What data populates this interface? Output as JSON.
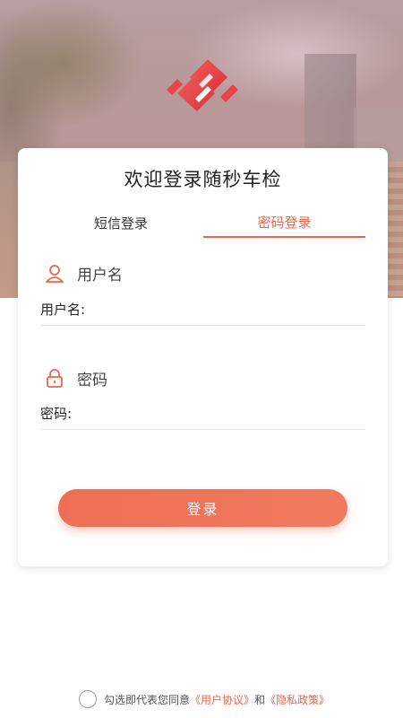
{
  "app": {
    "title": "欢迎登录随秒车检"
  },
  "tabs": [
    {
      "label": "短信登录",
      "active": false
    },
    {
      "label": "密码登录",
      "active": true
    }
  ],
  "username": {
    "section_label": "用户名",
    "placeholder": "用户名:",
    "value": ""
  },
  "password": {
    "section_label": "密码",
    "placeholder": "密码:",
    "value": ""
  },
  "login_button": {
    "label": "登录"
  },
  "agreement": {
    "checked": false,
    "prefix": "勾选即代表您同意",
    "user_agreement": "《用户协议》",
    "conjunction": "和",
    "privacy_policy": "《隐私政策》"
  },
  "colors": {
    "accent": "#e9674c",
    "button": "#ef7358",
    "logo_red": "#e8444b"
  },
  "icons": {
    "logo": "app-logo",
    "user": "user-icon",
    "lock": "lock-icon"
  }
}
